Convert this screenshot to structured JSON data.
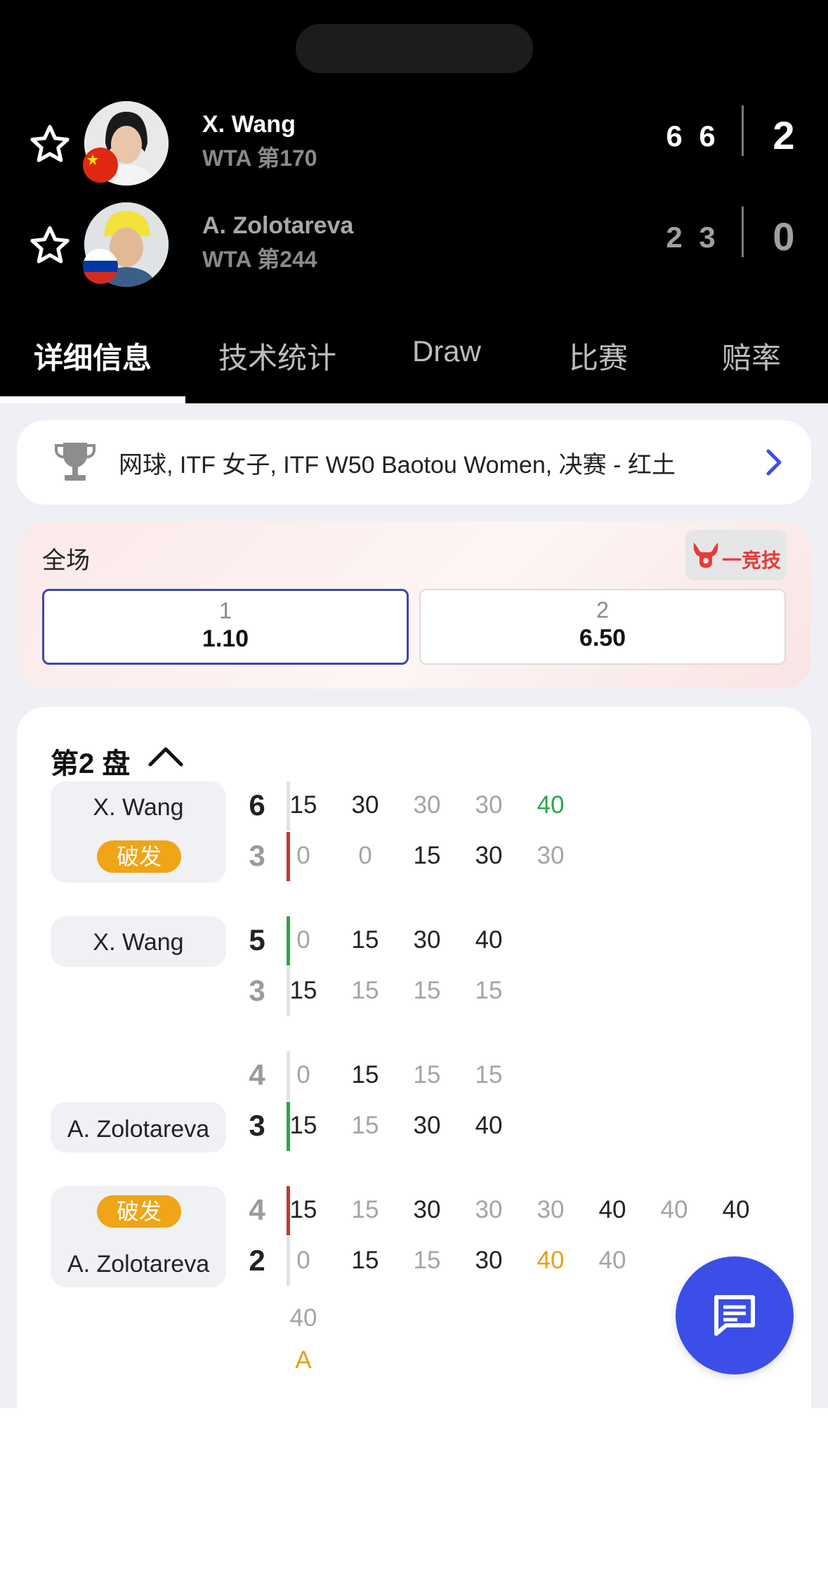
{
  "match": {
    "players": [
      {
        "name": "X. Wang",
        "rank": "WTA 第170",
        "sets": [
          "6",
          "6"
        ],
        "total": "2"
      },
      {
        "name": "A. Zolotareva",
        "rank": "WTA 第244",
        "sets": [
          "2",
          "3"
        ],
        "total": "0"
      }
    ]
  },
  "tabs": [
    {
      "label": "详细信息",
      "active": true
    },
    {
      "label": "技术统计",
      "active": false
    },
    {
      "label": "Draw",
      "active": false
    },
    {
      "label": "比赛",
      "active": false
    },
    {
      "label": "赔率",
      "active": false
    }
  ],
  "tournament": {
    "label": "网球, ITF 女子, ITF W50 Baotou Women, 决赛 - 红土"
  },
  "odds": {
    "title": "全场",
    "brand": "一竞技",
    "options": [
      {
        "label": "1",
        "value": "1.10",
        "selected": true
      },
      {
        "label": "2",
        "value": "6.50",
        "selected": false
      }
    ]
  },
  "pbp": {
    "set_title": "第2 盘",
    "break_label": "破发",
    "games": [
      {
        "server": "X. Wang",
        "badge": "破发",
        "rows": [
          {
            "game": "6",
            "points": [
              "15",
              "30",
              "30",
              "30",
              "40"
            ]
          },
          {
            "game": "3",
            "points": [
              "0",
              "0",
              "15",
              "30",
              "30"
            ]
          }
        ]
      },
      {
        "server": "X. Wang",
        "rows": [
          {
            "game": "5",
            "points": [
              "0",
              "15",
              "30",
              "40"
            ]
          },
          {
            "game": "3",
            "points": [
              "15",
              "15",
              "15",
              "15"
            ]
          }
        ]
      },
      {
        "server": "A. Zolotareva",
        "rows": [
          {
            "game": "4",
            "points": [
              "0",
              "15",
              "15",
              "15"
            ]
          },
          {
            "game": "3",
            "points": [
              "15",
              "15",
              "30",
              "40"
            ]
          }
        ]
      },
      {
        "server": "A. Zolotareva",
        "badge": "破发",
        "rows": [
          {
            "game": "4",
            "points": [
              "15",
              "15",
              "30",
              "30",
              "30",
              "40",
              "40",
              "40"
            ]
          },
          {
            "game": "2",
            "points": [
              "0",
              "15",
              "15",
              "30",
              "40",
              "40"
            ]
          }
        ],
        "extra": [
          "40",
          "A"
        ]
      }
    ]
  },
  "colors": {
    "header_bg": "#000000",
    "accent_blue": "#3b4ee8",
    "win_green": "#2ca84a",
    "break_red": "#c0392b",
    "badge_orange": "#f0a416"
  }
}
